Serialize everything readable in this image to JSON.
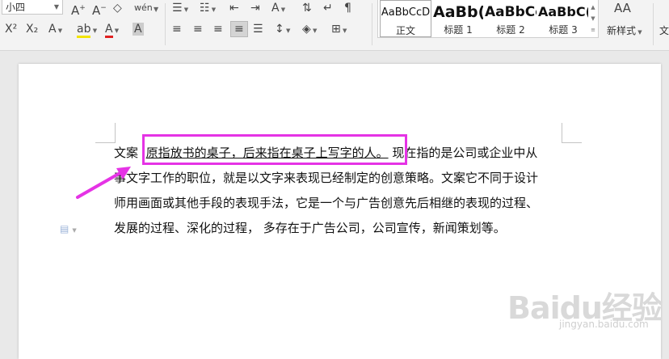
{
  "toolbar": {
    "font_size": "小四",
    "grow_font_icon": "A⁺",
    "shrink_font_icon": "A⁻",
    "superscript": "X²",
    "subscript": "X₂",
    "text_effect": "A",
    "highlight": "ab",
    "font_color": "A",
    "char_shading": "A",
    "phonetic": "wén"
  },
  "styles": {
    "items": [
      {
        "preview": "AaBbCcD",
        "label": "正文"
      },
      {
        "preview": "AaBb(",
        "label": "标题 1"
      },
      {
        "preview": "AaBbCc",
        "label": "标题 2"
      },
      {
        "preview": "AaBbC(",
        "label": "标题 3"
      }
    ],
    "new_style_icon": "AA",
    "new_style_label": "新样式",
    "right_cut_label": "文"
  },
  "document": {
    "line1_pre": "文案",
    "line1_highlight": "原指放书的桌子，后来指在桌子上写字的人。",
    "line1_post": "现在指的是公司或企业中从",
    "line2": "事文字工作的职位，就是以文字来表现已经制定的创意策略。文案它不同于设计",
    "line3": "师用画面或其他手段的表现手法，它是一个与广告创意先后相继的表现的过程、",
    "line4": "发展的过程、深化的过程，  多存在于广告公司，公司宣传，新闻策划等。"
  },
  "annotation": {
    "highlight_color": "#e533e5"
  },
  "watermark": {
    "main": "Baidu经验",
    "sub": "jingyan.baidu.com"
  }
}
